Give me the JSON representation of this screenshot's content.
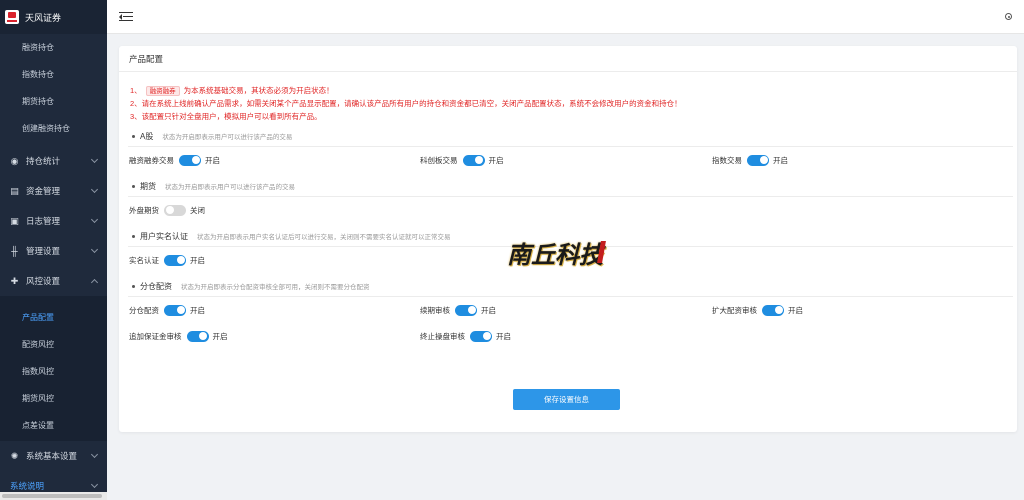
{
  "brand": {
    "name": "天风证券"
  },
  "sidebar": {
    "top_items": [
      {
        "label": "融资持仓"
      },
      {
        "label": "指数持仓"
      },
      {
        "label": "期货持仓"
      },
      {
        "label": "创建融资持仓"
      }
    ],
    "groups": {
      "stats": {
        "label": "持仓统计"
      },
      "funds": {
        "label": "资金管理"
      },
      "logs": {
        "label": "日志管理"
      },
      "manage": {
        "label": "管理设置"
      },
      "risk": {
        "label": "风控设置"
      },
      "system": {
        "label": "系统基本设置"
      },
      "help": {
        "label": "系统说明"
      }
    },
    "risk_items": [
      {
        "label": "产品配置"
      },
      {
        "label": "配资风控"
      },
      {
        "label": "指数风控"
      },
      {
        "label": "期货风控"
      },
      {
        "label": "点差设置"
      }
    ]
  },
  "card": {
    "title": "产品配置",
    "notes": {
      "n1_prefix": "1、",
      "n1_tag": "融资融券",
      "n1_suffix": "为本系统基础交易，其状态必须为开启状态！",
      "n2": "2、请在系统上线前确认产品需求，如需关闭某个产品显示配置，请确认该产品所有用户的持仓和资金都已清空，关闭产品配置状态，系统不会修改用户的资金和持仓！",
      "n3": "3、该配置只针对全盘用户，模拟用户可以看到所有产品。"
    },
    "sections": {
      "a": {
        "title": "A股",
        "desc": "状态为开启即表示用户可以进行该产品的交易"
      },
      "futures": {
        "title": "期货",
        "desc": "状态为开启即表示用户可以进行该产品的交易"
      },
      "realname": {
        "title": "用户实名认证",
        "desc": "状态为开启即表示用户实名认证后可以进行交易，关闭则不需要实名认证就可以正常交易"
      },
      "alloc": {
        "title": "分仓配资",
        "desc": "状态为开启即表示分仓配资审核全部可用，关闭则不需要分仓配资"
      }
    },
    "toggles": {
      "margin": {
        "label": "融资融券交易",
        "state": "开启"
      },
      "star": {
        "label": "科创板交易",
        "state": "开启"
      },
      "index": {
        "label": "指数交易",
        "state": "开启"
      },
      "foreign": {
        "label": "外盘期货",
        "state": "关闭"
      },
      "realname": {
        "label": "实名认证",
        "state": "开启"
      },
      "alloc": {
        "label": "分仓配资",
        "state": "开启"
      },
      "renew": {
        "label": "续期审核",
        "state": "开启"
      },
      "expand": {
        "label": "扩大配资审核",
        "state": "开启"
      },
      "margin_add": {
        "label": "追加保证金审核",
        "state": "开启"
      },
      "stop": {
        "label": "终止操盘审核",
        "state": "开启"
      }
    },
    "save_label": "保存设置信息"
  },
  "watermark": {
    "text": "南丘科技"
  },
  "colors": {
    "accent": "#2d96e8",
    "sidebar_bg": "#1f2a3c",
    "warning": "#e02424",
    "active_link": "#4da3ff"
  }
}
